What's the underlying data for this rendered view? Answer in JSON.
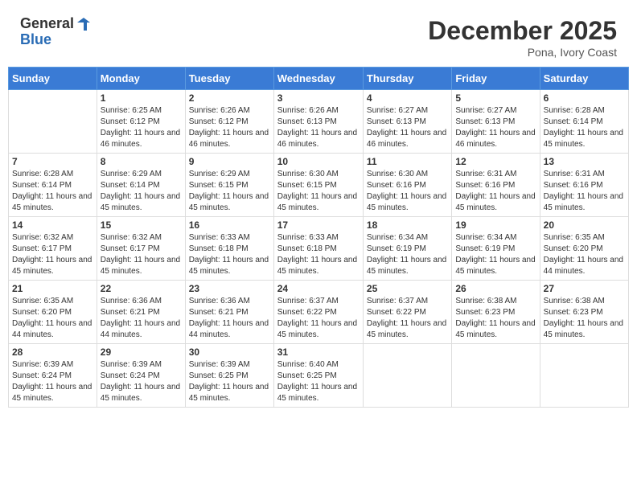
{
  "header": {
    "logo_line1": "General",
    "logo_line2": "Blue",
    "month": "December 2025",
    "location": "Pona, Ivory Coast"
  },
  "weekdays": [
    "Sunday",
    "Monday",
    "Tuesday",
    "Wednesday",
    "Thursday",
    "Friday",
    "Saturday"
  ],
  "weeks": [
    [
      {
        "day": "",
        "info": ""
      },
      {
        "day": "1",
        "info": "Sunrise: 6:25 AM\nSunset: 6:12 PM\nDaylight: 11 hours and 46 minutes."
      },
      {
        "day": "2",
        "info": "Sunrise: 6:26 AM\nSunset: 6:12 PM\nDaylight: 11 hours and 46 minutes."
      },
      {
        "day": "3",
        "info": "Sunrise: 6:26 AM\nSunset: 6:13 PM\nDaylight: 11 hours and 46 minutes."
      },
      {
        "day": "4",
        "info": "Sunrise: 6:27 AM\nSunset: 6:13 PM\nDaylight: 11 hours and 46 minutes."
      },
      {
        "day": "5",
        "info": "Sunrise: 6:27 AM\nSunset: 6:13 PM\nDaylight: 11 hours and 46 minutes."
      },
      {
        "day": "6",
        "info": "Sunrise: 6:28 AM\nSunset: 6:14 PM\nDaylight: 11 hours and 45 minutes."
      }
    ],
    [
      {
        "day": "7",
        "info": "Sunrise: 6:28 AM\nSunset: 6:14 PM\nDaylight: 11 hours and 45 minutes."
      },
      {
        "day": "8",
        "info": "Sunrise: 6:29 AM\nSunset: 6:14 PM\nDaylight: 11 hours and 45 minutes."
      },
      {
        "day": "9",
        "info": "Sunrise: 6:29 AM\nSunset: 6:15 PM\nDaylight: 11 hours and 45 minutes."
      },
      {
        "day": "10",
        "info": "Sunrise: 6:30 AM\nSunset: 6:15 PM\nDaylight: 11 hours and 45 minutes."
      },
      {
        "day": "11",
        "info": "Sunrise: 6:30 AM\nSunset: 6:16 PM\nDaylight: 11 hours and 45 minutes."
      },
      {
        "day": "12",
        "info": "Sunrise: 6:31 AM\nSunset: 6:16 PM\nDaylight: 11 hours and 45 minutes."
      },
      {
        "day": "13",
        "info": "Sunrise: 6:31 AM\nSunset: 6:16 PM\nDaylight: 11 hours and 45 minutes."
      }
    ],
    [
      {
        "day": "14",
        "info": "Sunrise: 6:32 AM\nSunset: 6:17 PM\nDaylight: 11 hours and 45 minutes."
      },
      {
        "day": "15",
        "info": "Sunrise: 6:32 AM\nSunset: 6:17 PM\nDaylight: 11 hours and 45 minutes."
      },
      {
        "day": "16",
        "info": "Sunrise: 6:33 AM\nSunset: 6:18 PM\nDaylight: 11 hours and 45 minutes."
      },
      {
        "day": "17",
        "info": "Sunrise: 6:33 AM\nSunset: 6:18 PM\nDaylight: 11 hours and 45 minutes."
      },
      {
        "day": "18",
        "info": "Sunrise: 6:34 AM\nSunset: 6:19 PM\nDaylight: 11 hours and 45 minutes."
      },
      {
        "day": "19",
        "info": "Sunrise: 6:34 AM\nSunset: 6:19 PM\nDaylight: 11 hours and 45 minutes."
      },
      {
        "day": "20",
        "info": "Sunrise: 6:35 AM\nSunset: 6:20 PM\nDaylight: 11 hours and 44 minutes."
      }
    ],
    [
      {
        "day": "21",
        "info": "Sunrise: 6:35 AM\nSunset: 6:20 PM\nDaylight: 11 hours and 44 minutes."
      },
      {
        "day": "22",
        "info": "Sunrise: 6:36 AM\nSunset: 6:21 PM\nDaylight: 11 hours and 44 minutes."
      },
      {
        "day": "23",
        "info": "Sunrise: 6:36 AM\nSunset: 6:21 PM\nDaylight: 11 hours and 44 minutes."
      },
      {
        "day": "24",
        "info": "Sunrise: 6:37 AM\nSunset: 6:22 PM\nDaylight: 11 hours and 45 minutes."
      },
      {
        "day": "25",
        "info": "Sunrise: 6:37 AM\nSunset: 6:22 PM\nDaylight: 11 hours and 45 minutes."
      },
      {
        "day": "26",
        "info": "Sunrise: 6:38 AM\nSunset: 6:23 PM\nDaylight: 11 hours and 45 minutes."
      },
      {
        "day": "27",
        "info": "Sunrise: 6:38 AM\nSunset: 6:23 PM\nDaylight: 11 hours and 45 minutes."
      }
    ],
    [
      {
        "day": "28",
        "info": "Sunrise: 6:39 AM\nSunset: 6:24 PM\nDaylight: 11 hours and 45 minutes."
      },
      {
        "day": "29",
        "info": "Sunrise: 6:39 AM\nSunset: 6:24 PM\nDaylight: 11 hours and 45 minutes."
      },
      {
        "day": "30",
        "info": "Sunrise: 6:39 AM\nSunset: 6:25 PM\nDaylight: 11 hours and 45 minutes."
      },
      {
        "day": "31",
        "info": "Sunrise: 6:40 AM\nSunset: 6:25 PM\nDaylight: 11 hours and 45 minutes."
      },
      {
        "day": "",
        "info": ""
      },
      {
        "day": "",
        "info": ""
      },
      {
        "day": "",
        "info": ""
      }
    ]
  ]
}
